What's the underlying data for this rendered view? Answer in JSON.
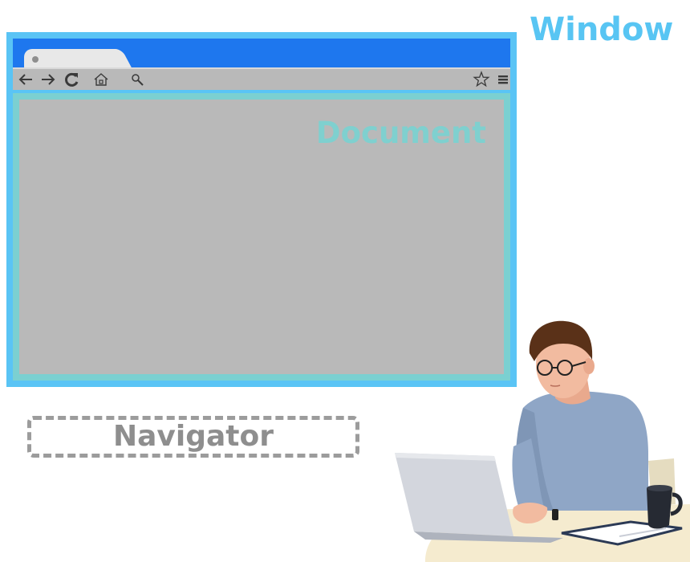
{
  "labels": {
    "window": "Window",
    "document": "Document",
    "navigator": "Navigator"
  },
  "toolbar": {
    "icons": [
      "back-arrow-icon",
      "forward-arrow-icon",
      "reload-icon",
      "home-icon",
      "search-icon",
      "star-icon",
      "menu-icon"
    ]
  },
  "colors": {
    "window_frame": "#5ac4f5",
    "title_bar": "#1e77ee",
    "document_frame": "#7bd0d1",
    "viewport": "#b9b9b9",
    "navigator_text": "#8e8e8e"
  }
}
